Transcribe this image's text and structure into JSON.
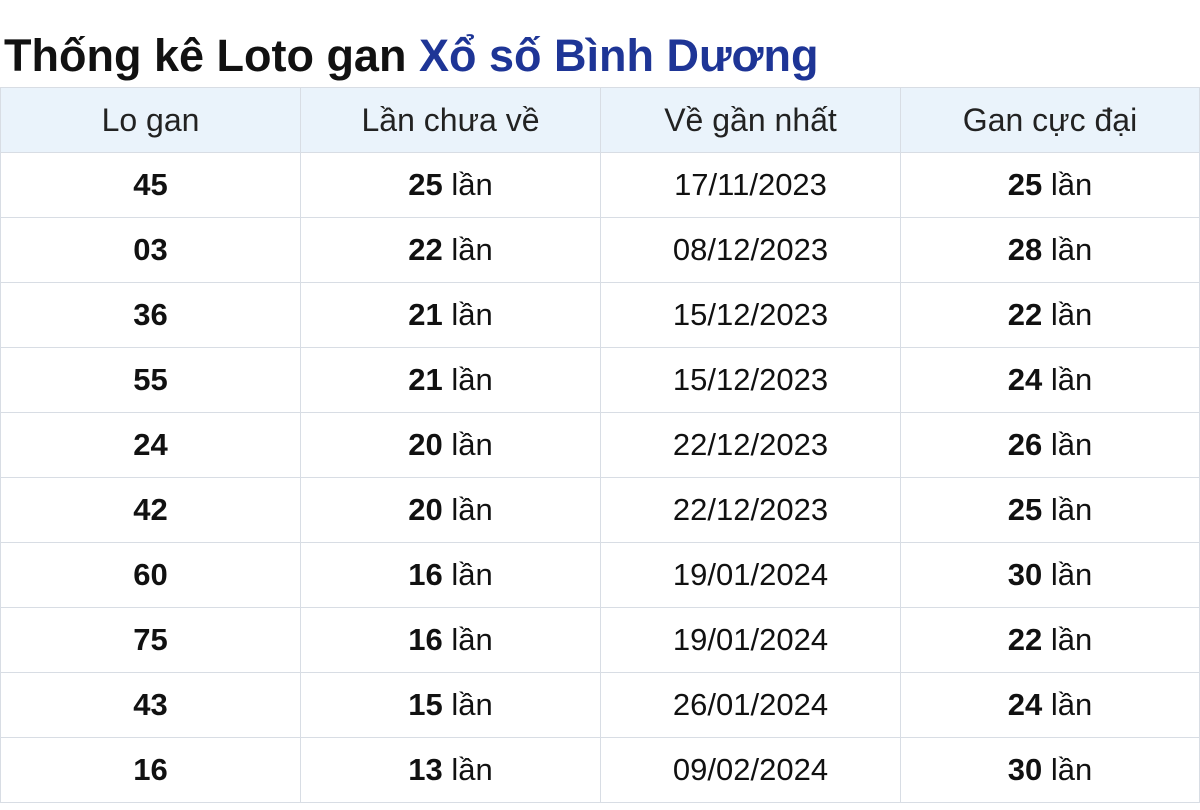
{
  "title": {
    "prefix": "Thống kê Loto gan",
    "link": "Xổ số Bình Dương"
  },
  "table": {
    "headers": [
      "Lo gan",
      "Lần chưa về",
      "Về gần nhất",
      "Gan cực đại"
    ],
    "unit": "lần",
    "rows": [
      {
        "lo": "45",
        "missed": "25",
        "last": "17/11/2023",
        "max": "25"
      },
      {
        "lo": "03",
        "missed": "22",
        "last": "08/12/2023",
        "max": "28"
      },
      {
        "lo": "36",
        "missed": "21",
        "last": "15/12/2023",
        "max": "22"
      },
      {
        "lo": "55",
        "missed": "21",
        "last": "15/12/2023",
        "max": "24"
      },
      {
        "lo": "24",
        "missed": "20",
        "last": "22/12/2023",
        "max": "26"
      },
      {
        "lo": "42",
        "missed": "20",
        "last": "22/12/2023",
        "max": "25"
      },
      {
        "lo": "60",
        "missed": "16",
        "last": "19/01/2024",
        "max": "30"
      },
      {
        "lo": "75",
        "missed": "16",
        "last": "19/01/2024",
        "max": "22"
      },
      {
        "lo": "43",
        "missed": "15",
        "last": "26/01/2024",
        "max": "24"
      },
      {
        "lo": "16",
        "missed": "13",
        "last": "09/02/2024",
        "max": "30"
      }
    ]
  },
  "colors": {
    "link": "#1e3596",
    "header_bg": "#eaf3fb",
    "border": "#d8dde4"
  }
}
